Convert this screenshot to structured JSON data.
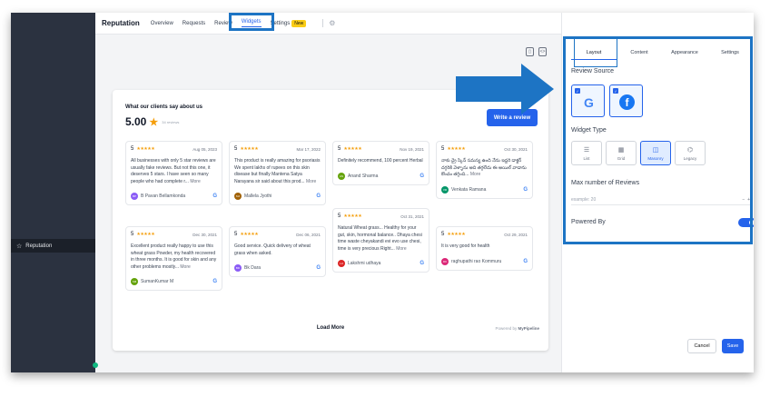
{
  "sidebar": {
    "items": [
      {
        "label": "Reputation",
        "icon": "star-icon"
      }
    ]
  },
  "topbar": {
    "brand": "Reputation",
    "nav": [
      "Overview",
      "Requests",
      "Review",
      "Widgets",
      "Settings"
    ],
    "active": "Widgets",
    "new_badge": "New"
  },
  "widget": {
    "title": "What our clients say about us",
    "score": "5.00",
    "review_count": "34 reviews",
    "write_button": "Write a review",
    "load_more": "Load More",
    "powered_prefix": "Powered by ",
    "powered_brand": "MyPipeline",
    "reviews": [
      {
        "rating": "5",
        "date": "Aug 05, 2023",
        "text": "All businesses with only 5 star reviews are usually fake reviews. But not this one, it deserves 5 stars. I have seen so many people who had complete r...",
        "more": "More",
        "author": "B Pavan Bellamkonda",
        "initials": "BP",
        "color": "#8b5cf6"
      },
      {
        "rating": "5",
        "date": "Mar 17, 2022",
        "text": "This product is really amazing for psoriasis We spent lakhs of rupees on this skin disease but finally Mantena Satya Narayana sir said about this prod...",
        "more": "More",
        "author": "Mallela Jyothi",
        "initials": "MJ",
        "color": "#a16207"
      },
      {
        "rating": "5",
        "date": "Nov 19, 2021",
        "text": "Definitely recommend, 100 percent Herbal",
        "more": "",
        "author": "Anand Sharma",
        "initials": "AS",
        "color": "#65a30d"
      },
      {
        "rating": "5",
        "date": "Oct 30, 2021",
        "text": "నాకు డ్రై స్కిన్ సమస్య ఉంది నేను ఇద్దరి డాక్టర్ దగ్గరికి వెళ్ళాను అది తగ్గలేదు ఈ ఆయిల్ వాడాను కొంచం తగ్గింది...",
        "more": "More",
        "author": "Venkata Ramana",
        "initials": "VR",
        "color": "#059669"
      },
      {
        "rating": "5",
        "date": "Dec 30, 2021",
        "text": "Excellent product really happy to use this wheat grass Powder, my health recovered in three months. It is good for skin and any other problems mostly...",
        "more": "More",
        "author": "SumanKumar M",
        "initials": "SM",
        "color": "#65a30d"
      },
      {
        "rating": "5",
        "date": "Dec 06, 2021",
        "text": "Good service. Quick delivery of wheat grass when asked.",
        "more": "",
        "author": "Bk Dara",
        "initials": "BD",
        "color": "#8b5cf6"
      },
      {
        "rating": "5",
        "date": "Oct 31, 2021",
        "text": "Natural Wheat grass... Healthy for your gut, skin, hormonal balance.. Dhaya chesi time waste cheyakandi evi evo use chesi, time is very precious Right...",
        "more": "More",
        "author": "Lakshmi udhaya",
        "initials": "LU",
        "color": "#dc2626"
      },
      {
        "rating": "5",
        "date": "Oct 29, 2021",
        "text": "It is very good for health",
        "more": "",
        "author": "raghupathi rao Kommuru",
        "initials": "RK",
        "color": "#db2777"
      }
    ]
  },
  "panel": {
    "tabs": [
      "Layout",
      "Content",
      "Appearance",
      "Settings"
    ],
    "active_tab": "Layout",
    "review_source_label": "Review Source",
    "sources": [
      {
        "name": "google",
        "glyph": "G",
        "checked": true
      },
      {
        "name": "facebook",
        "glyph": "f",
        "checked": true
      }
    ],
    "widget_type_label": "Widget Type",
    "widget_types": [
      "List",
      "Grid",
      "Masonry",
      "Legacy"
    ],
    "active_type": "Masonry",
    "max_reviews_label": "Max number of Reviews",
    "max_reviews_placeholder": "example: 20",
    "powered_by_label": "Powered By",
    "powered_by_enabled": true,
    "cancel": "Cancel",
    "save": "Save"
  }
}
